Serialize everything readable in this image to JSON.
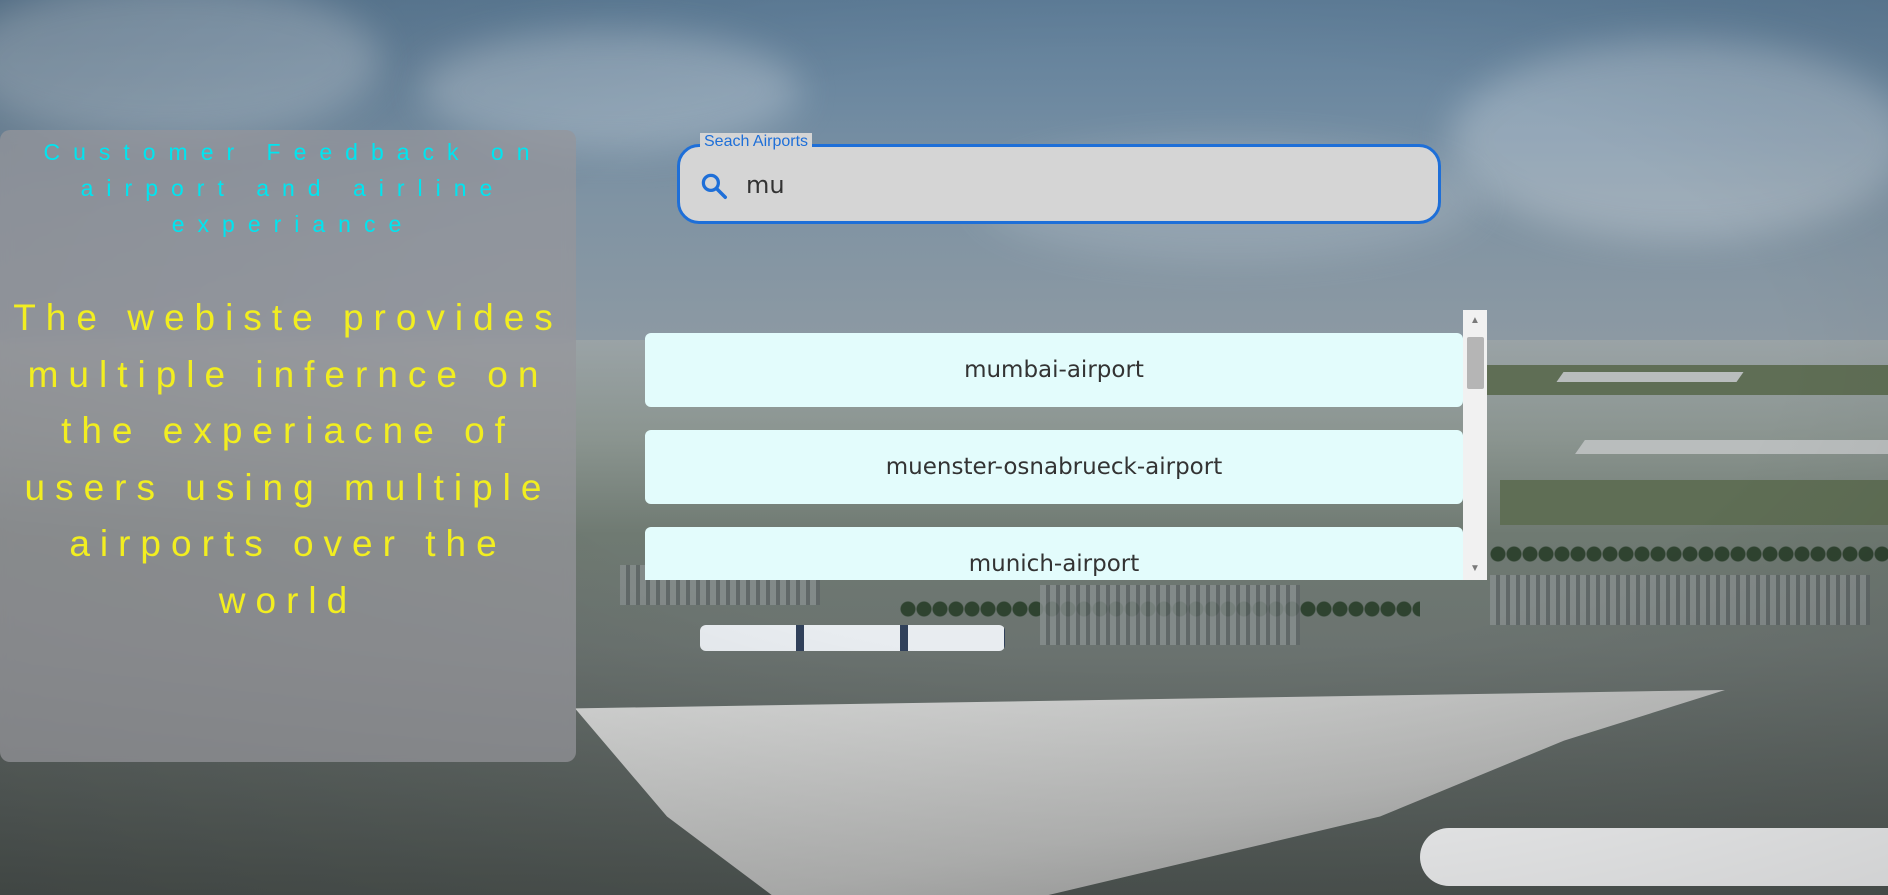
{
  "info_panel": {
    "title": "Customer Feedback on airport and airline experiance",
    "body": "The webiste provides multiple infernce on the experiacne of users using multiple airports over the world",
    "colors": {
      "title": "#00e5f0",
      "body": "#f2ee20"
    }
  },
  "search": {
    "label": "Seach Airports",
    "value": "mu",
    "icon": "search-icon",
    "accent": "#1e6fd8"
  },
  "results": [
    {
      "label": "mumbai-airport"
    },
    {
      "label": "muenster-osnabrueck-airport"
    },
    {
      "label": "munich-airport"
    }
  ]
}
